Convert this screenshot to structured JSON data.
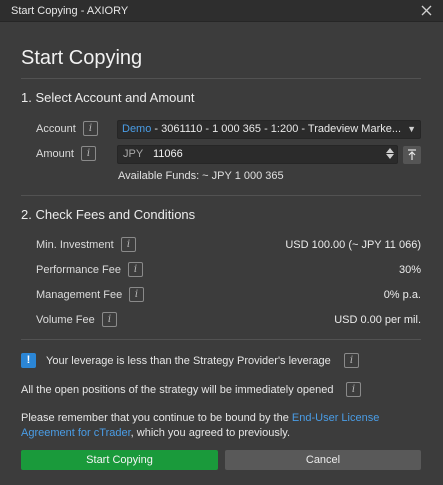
{
  "window": {
    "title": "Start Copying - AXIORY"
  },
  "heading": "Start Copying",
  "section1": {
    "title": "1. Select Account and Amount",
    "account_label": "Account",
    "account_tag": "Demo",
    "account_value": " - 3061110 - 1 000 365 - 1:200 - Tradeview Marke...",
    "amount_label": "Amount",
    "amount_currency": "JPY",
    "amount_value": "11066",
    "available_funds": "Available Funds:  ~ JPY 1 000 365"
  },
  "section2": {
    "title": "2. Check Fees and Conditions",
    "rows": [
      {
        "label": "Min. Investment",
        "value": "USD 100.00 (~ JPY 11 066)"
      },
      {
        "label": "Performance Fee",
        "value": "30%"
      },
      {
        "label": "Management Fee",
        "value": "0% p.a."
      },
      {
        "label": "Volume Fee",
        "value": "USD 0.00 per mil."
      }
    ]
  },
  "warnings": {
    "leverage": "Your leverage is less than the Strategy Provider's leverage",
    "positions": "All the open positions of the strategy will be immediately opened"
  },
  "notice": {
    "prefix": "Please remember that you continue to be bound by the ",
    "link": "End-User License Agreement for cTrader",
    "suffix": ", which you agreed to previously."
  },
  "buttons": {
    "start": "Start Copying",
    "cancel": "Cancel"
  },
  "icons": {
    "info": "i",
    "warning": "!"
  },
  "colors": {
    "accent_link": "#4a9de6",
    "primary_button": "#1a9a3b",
    "warning_icon": "#2b86d6"
  }
}
